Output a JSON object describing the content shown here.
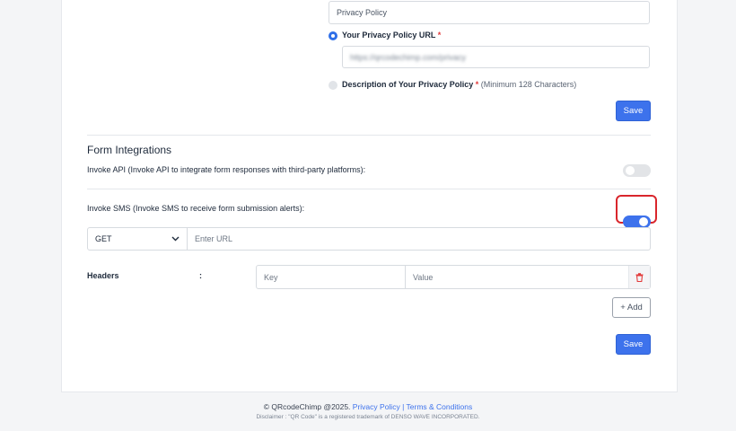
{
  "privacy": {
    "title_value": "Privacy Policy",
    "url_option_label": "Your Privacy Policy URL",
    "url_value": "https://qrcodechimp.com/privacy",
    "description_option_label": "Description of Your Privacy Policy",
    "description_note": "(Minimum 128 Characters)",
    "required_mark": "*",
    "save_label": "Save"
  },
  "integrations": {
    "title": "Form Integrations",
    "invoke_api": {
      "label": "Invoke API (Invoke API to integrate form responses with third-party platforms):",
      "enabled": false
    },
    "invoke_sms": {
      "label": "Invoke SMS (Invoke SMS to receive form submission alerts):",
      "enabled": true
    },
    "method": "GET",
    "url_placeholder": "Enter URL",
    "headers_label": "Headers",
    "headers_separator": ":",
    "key_placeholder": "Key",
    "value_placeholder": "Value",
    "add_label": "+ Add",
    "save_label": "Save"
  },
  "footer": {
    "copyright": "© QRcodeChimp @2025.",
    "privacy_link": "Privacy Policy",
    "separator": "|",
    "terms_link": "Terms & Conditions",
    "disclaimer": "Disclaimer : \"QR Code\" is a registered trademark of DENSO WAVE INCORPORATED."
  },
  "colors": {
    "primary": "#3d72ec",
    "required": "#e23b3b",
    "highlight": "#d9262c",
    "delete": "#e23b3b"
  },
  "icons": {
    "select_arrow": "chevron-down-icon",
    "delete": "trash-icon"
  }
}
